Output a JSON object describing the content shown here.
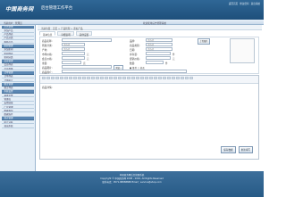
{
  "header": {
    "logo": "中国商务网",
    "subtitle": "后台管理工作平台",
    "topnav": [
      "返回首页",
      "修改密码",
      "退出系统"
    ]
  },
  "subbar": {
    "left": "当前用户：管理员",
    "right": "欢迎使用后台管理系统"
  },
  "sidebar": {
    "items": [
      "产品管理",
      "添加产品",
      "产品列表",
      "产品分类",
      "推荐产品",
      "新闻管理",
      "添加新闻",
      "新闻列表",
      "新闻分类",
      "会员管理",
      "会员列表",
      "会员等级",
      "订单管理",
      "订单列表",
      "订单统计",
      "留言管理",
      "留言列表",
      "系统设置",
      "基本设置",
      "管理员",
      "友情链接",
      "广告管理",
      "数据备份",
      "数据恢复",
      "日志管理",
      "统计分析",
      "退出系统"
    ],
    "heads": [
      0,
      5,
      9,
      12,
      15,
      17,
      24
    ]
  },
  "breadcrumb": "当前位置：首页 > 产品管理 > 添加产品",
  "tabs": [
    "基本信息",
    "详细说明",
    "其他设置"
  ],
  "form": {
    "row1": {
      "name_label": "商品名称:",
      "brand_label": "品牌:",
      "brand_value": "请选择",
      "img_btn": "上传图片"
    },
    "row2": {
      "type_label": "所属分类:",
      "type_value": "请选择",
      "cat_label": "商品类别:",
      "cat_value": "请选择"
    },
    "row3": {
      "origin_label": "产地:",
      "origin_value": "请选择",
      "level_label": "日期:",
      "level_value": "请选择"
    },
    "row4": {
      "price_label": "市场价格:",
      "price_unit": "元",
      "stock_label": "库存量:",
      "stock_unit": "件"
    },
    "row5": {
      "member_label": "会员价格:",
      "member_unit": "元",
      "vip_label": "促销价格:",
      "vip_unit": "元"
    },
    "row6": {
      "weight_label": "重量:",
      "weight_unit": "克",
      "count_label": "数量:",
      "count_unit": "件"
    },
    "row7": {
      "pic_label": "商品图片:",
      "pic_btn": "浏览...",
      "radio": "● 推荐 ○ 热卖"
    },
    "row8": {
      "desc_label": "商品简介:"
    }
  },
  "editor": {
    "label": "商品详情:"
  },
  "actions": {
    "save": "保存数据",
    "reset": "重新填写"
  },
  "footer": {
    "line1": "中国商务网后台管理系统",
    "line2": "Copyright © 中国商务网 2008 - 2016, All Rights Reserved",
    "line3": "联系电话：0571-88888888  Email：service@shop.com"
  }
}
